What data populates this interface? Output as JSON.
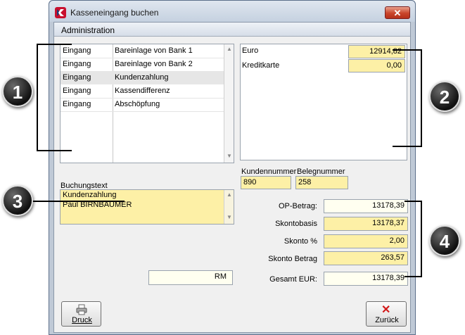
{
  "window": {
    "title": "Kasseneingang buchen",
    "close_label": "✕"
  },
  "menu": {
    "items": [
      "Administration"
    ]
  },
  "booking_list": {
    "rows": [
      {
        "type": "Eingang",
        "text": "Bareinlage von Bank 1"
      },
      {
        "type": "Eingang",
        "text": "Bareinlage von Bank 2"
      },
      {
        "type": "Eingang",
        "text": "Kundenzahlung"
      },
      {
        "type": "Eingang",
        "text": "Kassendifferenz"
      },
      {
        "type": "Eingang",
        "text": "Abschöpfung"
      }
    ],
    "selected_index": 2
  },
  "payment_list": {
    "rows": [
      {
        "label": "Euro",
        "value": "12914,82"
      },
      {
        "label": "Kreditkarte",
        "value": "0,00"
      }
    ]
  },
  "customer": {
    "number_label": "Kundennummer",
    "number_value": "890",
    "receipt_label": "Belegnummer",
    "receipt_value": "258"
  },
  "booking_text": {
    "label": "Buchungstext",
    "line1": "Kundenzahlung",
    "line2": "Paul BIRNBAUMER"
  },
  "totals": {
    "op_label": "OP-Betrag:",
    "op_value": "13178,39",
    "basis_label": "Skontobasis",
    "basis_value": "13178,37",
    "pct_label": "Skonto %",
    "pct_value": "2,00",
    "amount_label": "Skonto Betrag",
    "amount_value": "263,57",
    "total_label": "Gesamt EUR:",
    "total_value": "13178,39"
  },
  "rm_field": {
    "value": "RM"
  },
  "buttons": {
    "print": "Druck",
    "back": "Zurück"
  },
  "callouts": [
    "1",
    "2",
    "3",
    "4"
  ],
  "colors": {
    "field_yellow": "#fdf0a6",
    "window_frame": "#bfc9d6",
    "close_red": "#c9452b"
  }
}
